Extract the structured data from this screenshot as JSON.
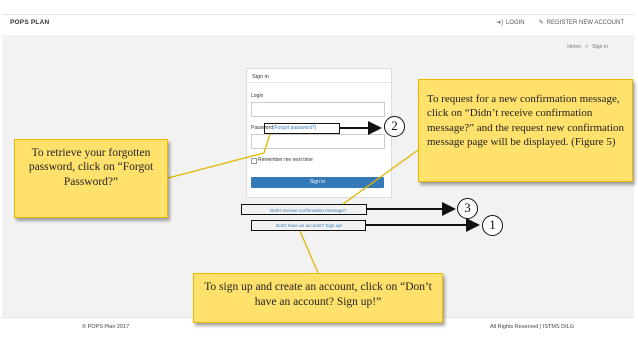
{
  "navbar": {
    "brand": "POPS PLAN",
    "login": "LOGIN",
    "register": "REGISTER NEW ACCOUNT",
    "login_icon": "sign-in-icon",
    "register_icon": "edit-icon"
  },
  "breadcrumb": {
    "home": "Home",
    "separator": ">",
    "current": "Sign in"
  },
  "panel": {
    "title": "Sign in",
    "login_label": "Login",
    "password_label": "Password",
    "forgot_link": "(Forgot password?)",
    "remember_label": "Remember me next time",
    "signin_button": "Sign in"
  },
  "links": {
    "resend": "Didn't receive confirmation message?",
    "signup": "Don't have an account? Sign up!"
  },
  "footer": {
    "left": "© POPS Plan 2017",
    "right": "All Rights Reserved | ISTMS DILG"
  },
  "callouts": {
    "forgot": "To retrieve your forgotten password, click on “Forgot Password?”",
    "resend": "To request for a new confirmation message, click on “Didn’t receive confirmation message?” and the request new confirmation message page will be displayed. (Figure 5)",
    "signup": "To sign up and create an account, click on “Don’t have an account? Sign up!”"
  },
  "markers": {
    "one": "1",
    "two": "2",
    "three": "3"
  },
  "colors": {
    "callout_fill": "#ffe16b",
    "primary_button": "#337ab7",
    "link": "#337ab7"
  }
}
